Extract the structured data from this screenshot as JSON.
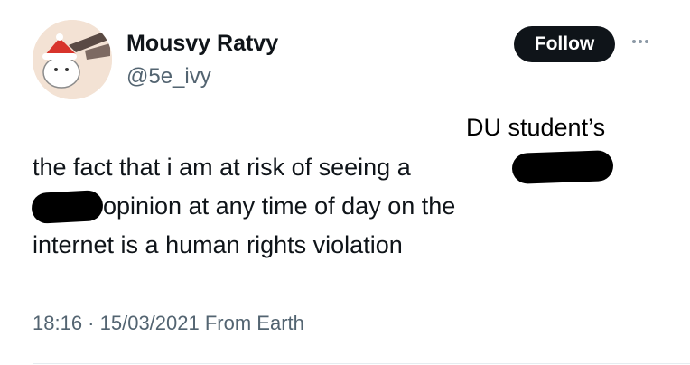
{
  "author": {
    "display_name": "Mousvy Ratvy",
    "handle": "@5e_ivy",
    "avatar_icon": "santa-hat-avatar-icon"
  },
  "follow_button": {
    "label": "Follow"
  },
  "more_icon": "more-dots-icon",
  "annotation": "DU student’s",
  "tweet": {
    "line1": "the fact that i am at risk of seeing a",
    "line2": "opinion at any time of day on the",
    "line3": "internet is a human rights violation"
  },
  "meta": {
    "time": "18:16",
    "separator": " · ",
    "date": "15/03/2021",
    "source": " From Earth"
  },
  "colors": {
    "follow_bg": "#0f1419",
    "text": "#0f1419",
    "secondary": "#536471",
    "redaction": "#000000"
  }
}
